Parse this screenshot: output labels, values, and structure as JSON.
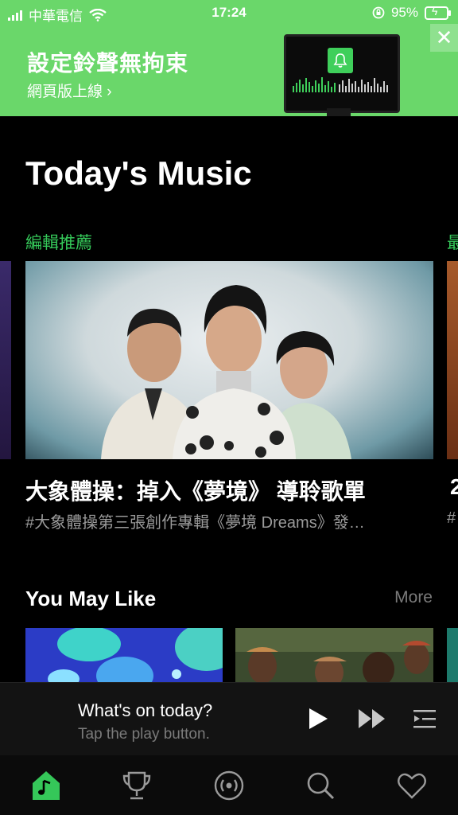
{
  "status_bar": {
    "carrier": "中華電信",
    "time": "17:24",
    "battery": "95%"
  },
  "banner": {
    "title": "設定鈴聲無拘束",
    "link": "網頁版上線 ›",
    "close": "✕",
    "colors": {
      "background": "#6ad76a"
    }
  },
  "main": {
    "title": "Today's Music",
    "section_label": "編輯推薦",
    "next_section_label_peek": "最",
    "hero": {
      "title": "大象體操：掉入《夢境》 導聆歌單",
      "subtitle": "#大象體操第三張創作專輯《夢境 Dreams》發…",
      "next_title_peek": "2",
      "next_sub_peek": "#"
    },
    "you_may_like": {
      "title": "You May Like",
      "more": "More"
    }
  },
  "mini_player": {
    "title": "What's on today?",
    "subtitle": "Tap the play button."
  },
  "tab_bar": {
    "items": [
      {
        "name": "home",
        "icon": "music-note-house-icon",
        "active": true
      },
      {
        "name": "charts",
        "icon": "trophy-icon",
        "active": false
      },
      {
        "name": "radio",
        "icon": "broadcast-icon",
        "active": false
      },
      {
        "name": "search",
        "icon": "search-icon",
        "active": false
      },
      {
        "name": "favorites",
        "icon": "heart-icon",
        "active": false
      }
    ],
    "colors": {
      "accent": "#35c759"
    }
  }
}
